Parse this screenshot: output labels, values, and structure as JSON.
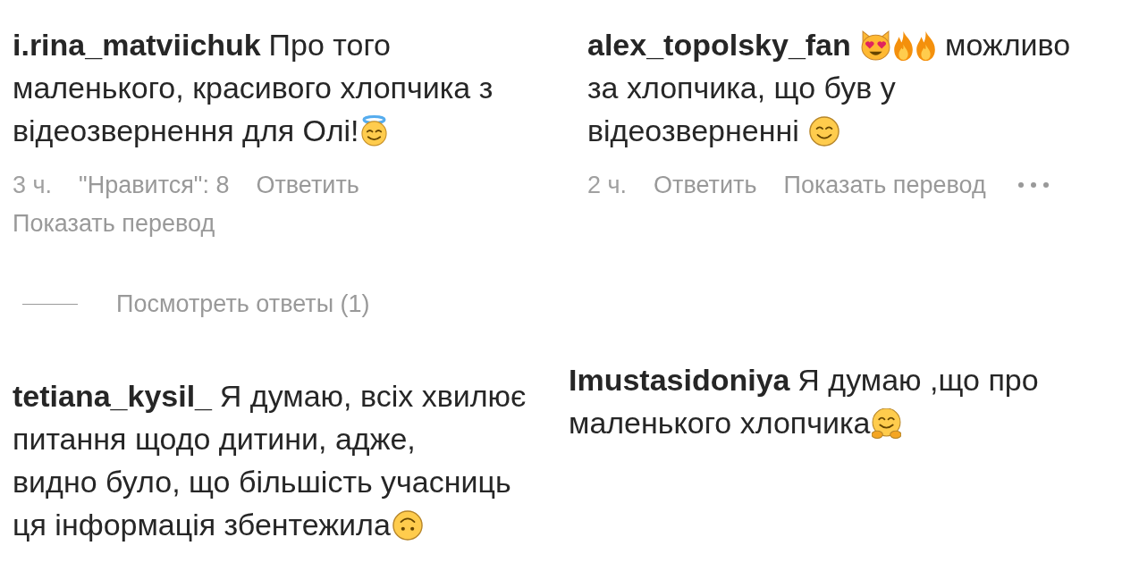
{
  "comments": [
    {
      "username": "i.rina_matviichuk",
      "body": [
        {
          "kind": "text",
          "text": "Про того маленького, красивого хлопчика з відеозвернення для Олі!"
        },
        {
          "kind": "halo"
        }
      ],
      "meta": {
        "time": "3 ч.",
        "likes": "\"Нравится\": 8",
        "reply": "Ответить",
        "translate": "Показать перевод"
      },
      "replies": {
        "label": "Посмотреть ответы (1)"
      }
    },
    {
      "username": "alex_topolsky_fan",
      "body": [
        {
          "kind": "heart_cat"
        },
        {
          "kind": "fire"
        },
        {
          "kind": "fire"
        },
        {
          "kind": "text",
          "text": " можливо за хлопчика, що був у відеозверненні "
        },
        {
          "kind": "smile"
        }
      ],
      "meta": {
        "time": "2 ч.",
        "reply": "Ответить",
        "translate": "Показать перевод"
      },
      "more_menu": true
    },
    {
      "username": "tetiana_kysil_",
      "body": [
        {
          "kind": "text",
          "text": "Я думаю, всіх хвилює питання щодо дитини, адже,\nвидно було, що більшість учасниць ця інформація збентежила"
        },
        {
          "kind": "upside_down"
        }
      ]
    },
    {
      "username": "Imustasidoniya",
      "body": [
        {
          "kind": "text",
          "text": "Я думаю ,що про маленького хлопчика"
        },
        {
          "kind": "hug"
        }
      ]
    }
  ]
}
